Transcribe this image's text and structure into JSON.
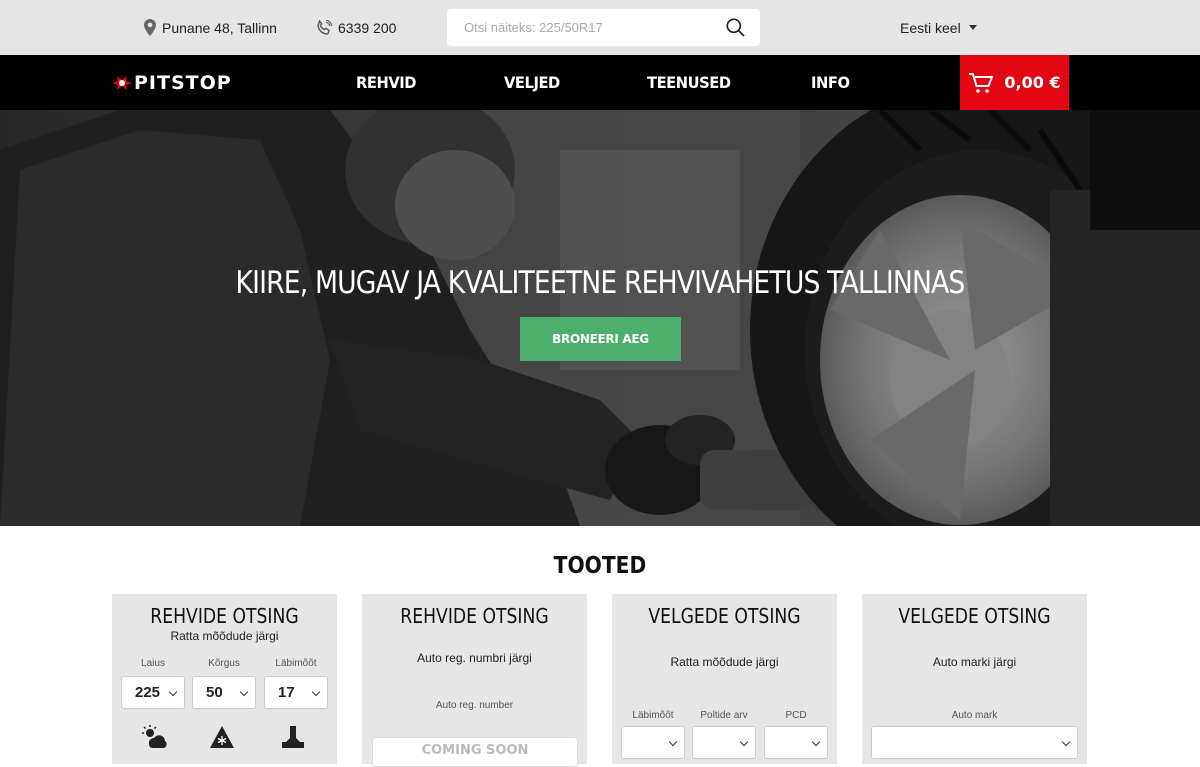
{
  "topbar": {
    "address": "Punane 48, Tallinn",
    "phone": "6339 200",
    "search_placeholder": "Otsi näiteks: 225/50R17",
    "language": "Eesti keel"
  },
  "nav": {
    "logo_text": "PITSTOP",
    "links": [
      "REHVID",
      "VELJED",
      "TEENUSED",
      "INFO"
    ],
    "cart_total": "0,00 €"
  },
  "hero": {
    "title": "KIIRE, MUGAV JA KVALITEETNE REHVIVAHETUS TALLINNAS",
    "button": "BRONEERI AEG"
  },
  "products": {
    "title": "TOOTED",
    "cards": [
      {
        "title": "REHVIDE OTSING",
        "subtitle": "Ratta mõõdude järgi",
        "fields": [
          {
            "label": "Laius",
            "value": "225"
          },
          {
            "label": "Kõrgus",
            "value": "50"
          },
          {
            "label": "Läbimõõt",
            "value": "17"
          }
        ],
        "season_icons": [
          "summer-winter-icon",
          "winter-icon",
          "studded-icon"
        ]
      },
      {
        "title": "REHVIDE OTSING",
        "subtitle": "Auto reg. numbri järgi",
        "field_label": "Auto reg. number",
        "input_value": "COMING SOON"
      },
      {
        "title": "VELGEDE OTSING",
        "subtitle": "Ratta mõõdude järgi",
        "fields": [
          {
            "label": "Läbimõõt",
            "value": ""
          },
          {
            "label": "Poltide arv",
            "value": ""
          },
          {
            "label": "PCD",
            "value": ""
          }
        ]
      },
      {
        "title": "VELGEDE OTSING",
        "subtitle": "Auto marki järgi",
        "field_label": "Auto mark",
        "value": ""
      }
    ]
  },
  "colors": {
    "accent_red": "#e30613",
    "cta_green": "#4caf6e",
    "nav_bg": "#000000",
    "topbar_bg": "#e5e5e5"
  }
}
